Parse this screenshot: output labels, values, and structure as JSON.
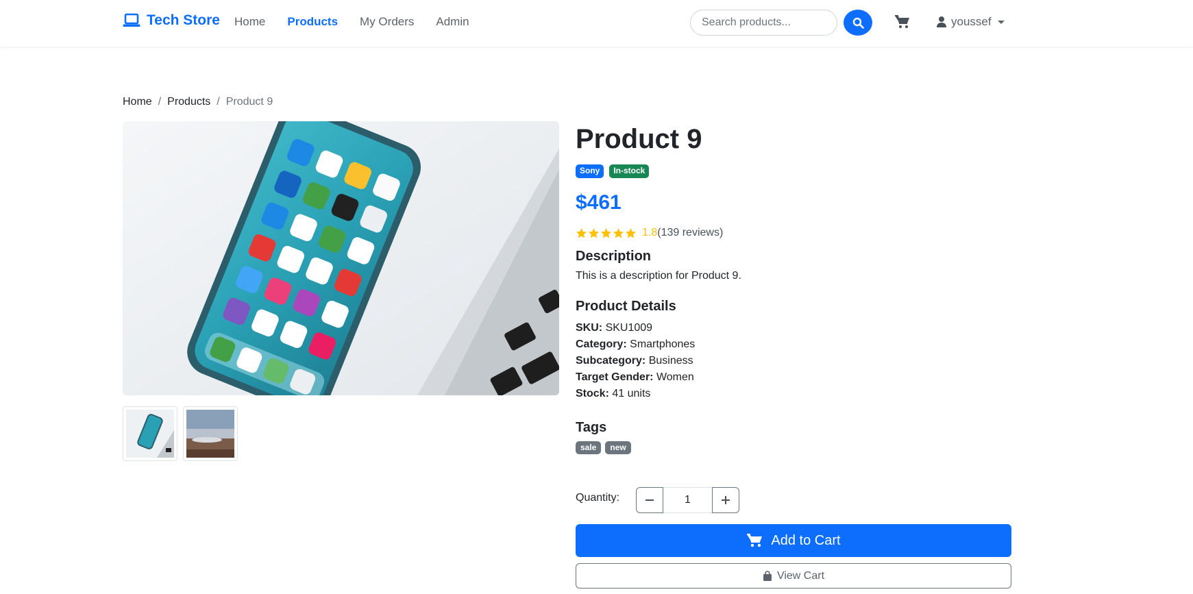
{
  "nav": {
    "brand": "Tech Store",
    "links": [
      "Home",
      "Products",
      "My Orders",
      "Admin"
    ],
    "active": "Products",
    "search_placeholder": "Search products...",
    "user": "youssef"
  },
  "breadcrumb": [
    "Home",
    "Products",
    "Product 9"
  ],
  "product": {
    "title": "Product 9",
    "brand_badge": "Sony",
    "stock_badge": "In-stock",
    "price": "$461",
    "rating": "1.8",
    "rating_stars_filled": 5,
    "reviews": "(139 reviews)",
    "description_heading": "Description",
    "description": "This is a description for Product 9.",
    "details_heading": "Product Details",
    "details": [
      {
        "label": "SKU:",
        "value": "SKU1009"
      },
      {
        "label": "Category:",
        "value": "Smartphones"
      },
      {
        "label": "Subcategory:",
        "value": "Business"
      },
      {
        "label": "Target Gender:",
        "value": "Women"
      },
      {
        "label": "Stock:",
        "value": "41 units"
      }
    ],
    "tags_heading": "Tags",
    "tags": [
      "sale",
      "new"
    ]
  },
  "purchase": {
    "quantity_label": "Quantity:",
    "quantity": "1",
    "add_to_cart": "Add to Cart",
    "view_cart": "View Cart"
  },
  "colors": {
    "primary": "#0d6efd",
    "success": "#198754",
    "secondary": "#6c757d",
    "star": "#ffc107"
  }
}
